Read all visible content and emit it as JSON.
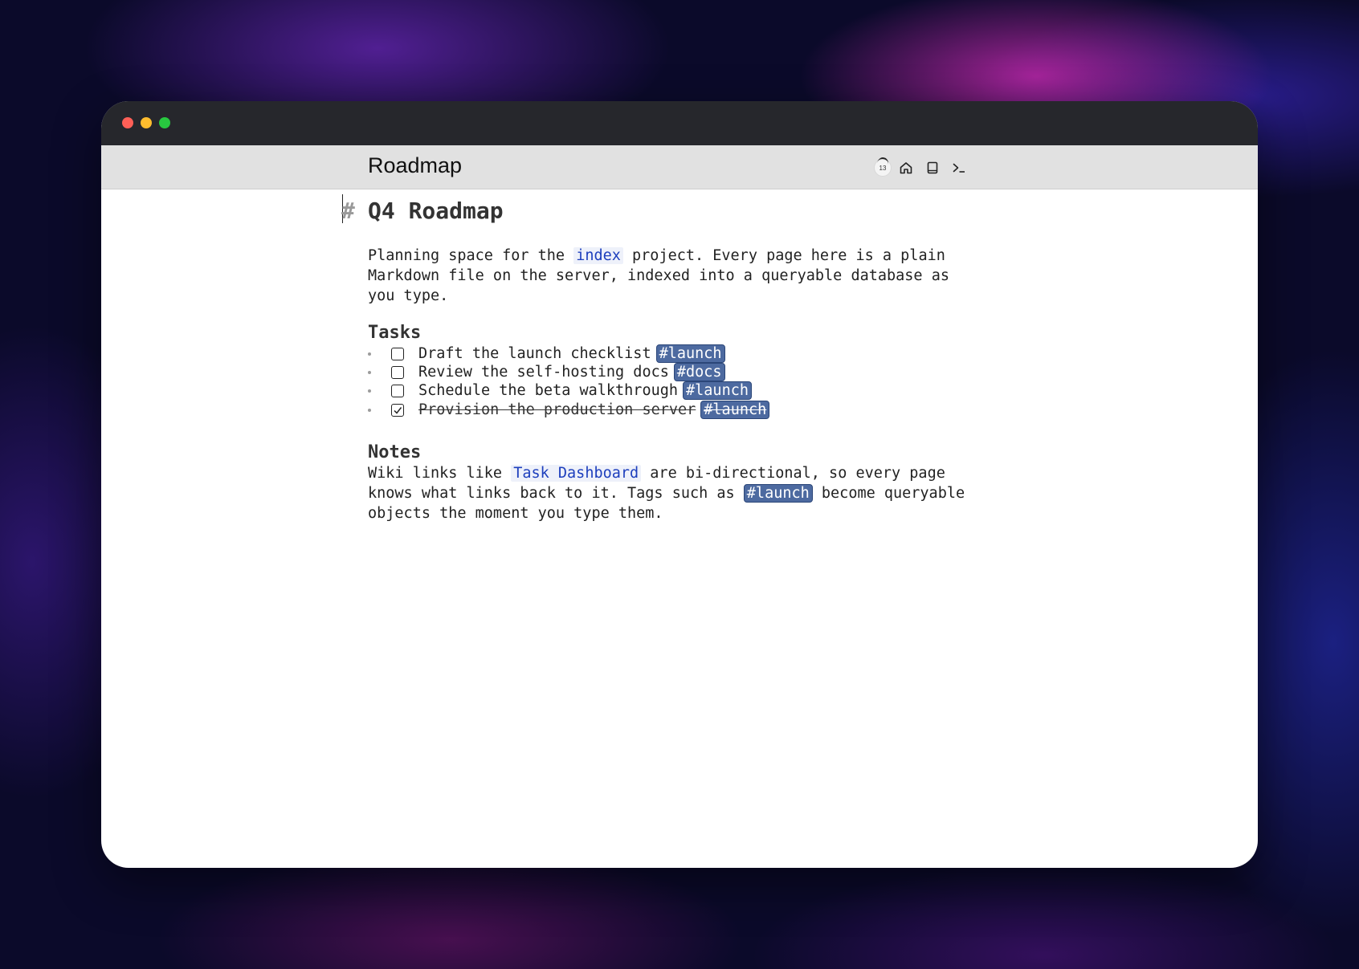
{
  "page": {
    "name": "Roadmap",
    "sync_count": "13"
  },
  "toolbar": {
    "icons": [
      "sync-icon",
      "home-icon",
      "book-icon",
      "terminal-icon"
    ]
  },
  "document": {
    "h1_marker": "#",
    "title": "Q4 Roadmap",
    "intro": {
      "before": "Planning space for the ",
      "link": "index",
      "after": " project. Every page here is a plain Markdown file on the server, indexed into a queryable database as you type."
    },
    "tasks_heading": "Tasks",
    "tasks": [
      {
        "text": "Draft the launch checklist",
        "tag": "#launch",
        "done": false
      },
      {
        "text": "Review the self-hosting docs",
        "tag": "#docs",
        "done": false
      },
      {
        "text": "Schedule the beta walkthrough",
        "tag": "#launch",
        "done": false
      },
      {
        "text": "Provision the production server",
        "tag": "#launch",
        "done": true
      }
    ],
    "notes_heading": "Notes",
    "notes": {
      "before": "Wiki links like ",
      "link": "Task Dashboard",
      "middle": " are bi-directional, so every page knows what links back to it. Tags such as ",
      "tag": "#launch",
      "after": " become queryable objects the moment you type them."
    }
  },
  "colors": {
    "link": "#1d3fbd",
    "tag_bg": "#4d6aa0",
    "header_bg": "#e1e1e1",
    "titlebar_bg": "#26272c"
  }
}
